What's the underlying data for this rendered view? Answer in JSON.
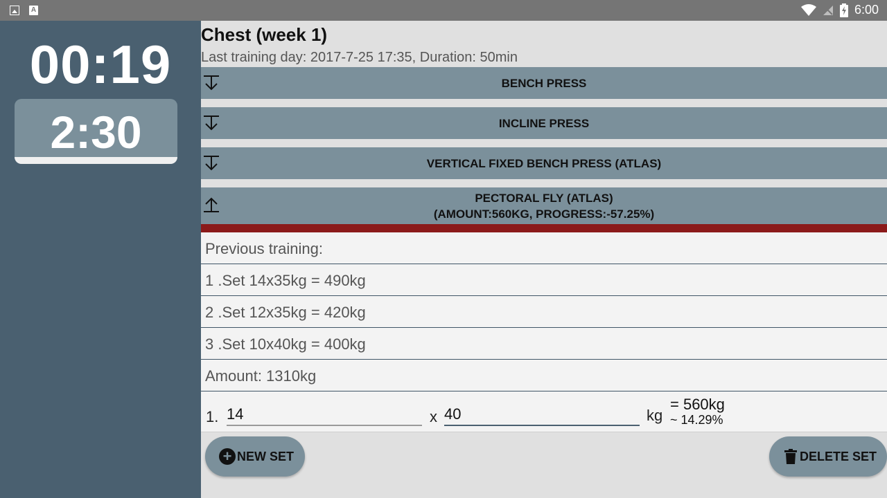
{
  "status_bar": {
    "time": "6:00",
    "left_icons": [
      "image-icon",
      "font-icon"
    ],
    "right_icons": [
      "wifi-icon",
      "no-signal-icon",
      "battery-charging-icon"
    ]
  },
  "left_panel": {
    "timer": "00:19",
    "rest_time": "2:30"
  },
  "header": {
    "title": "Chest (week 1)",
    "subtitle": "Last training day: 2017-7-25 17:35, Duration: 50min"
  },
  "exercises": [
    {
      "name": "BENCH PRESS",
      "state": "collapsed"
    },
    {
      "name": "INCLINE PRESS",
      "state": "collapsed"
    },
    {
      "name": "VERTICAL FIXED BENCH PRESS (ATLAS)",
      "state": "collapsed"
    },
    {
      "name": "PECTORAL FLY (ATLAS)",
      "detail": "(AMOUNT:560KG, PROGRESS:-57.25%)",
      "state": "expanded"
    }
  ],
  "previous": {
    "heading": "Previous training:",
    "sets": [
      "1 .Set 14x35kg = 490kg",
      "2 .Set 12x35kg = 420kg",
      "3 .Set 10x40kg = 400kg"
    ],
    "amount": "Amount: 1310kg"
  },
  "entry": {
    "number": "1.",
    "reps": "14",
    "times": "x",
    "weight": "40",
    "unit": "kg",
    "result": "= 560kg",
    "percent": "~ 14.29%"
  },
  "buttons": {
    "new_set": "NEW SET",
    "delete_set": "DELETE SET"
  },
  "colors": {
    "panel": "#4a6070",
    "header_bg": "#7b909b",
    "accent_red": "#8b1a1a",
    "status_bar": "#757575"
  }
}
